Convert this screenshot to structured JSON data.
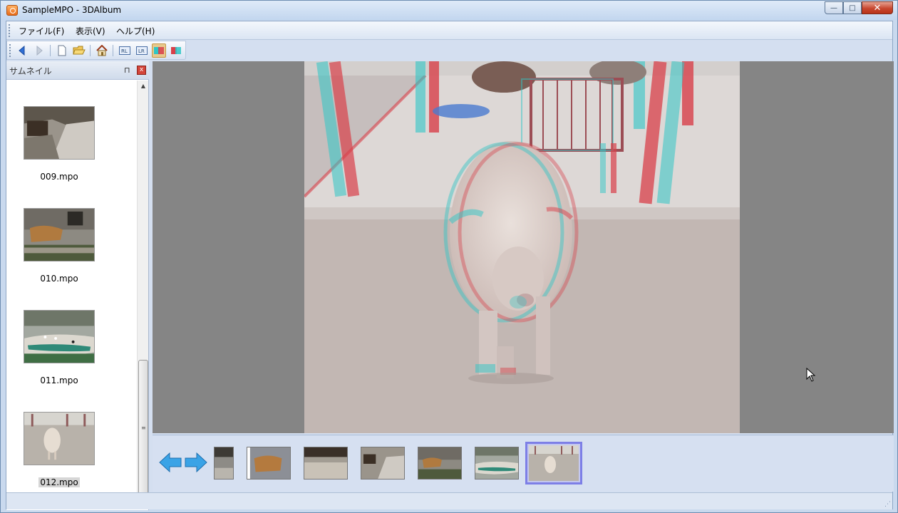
{
  "window": {
    "title": "SampleMPO - 3DAlbum",
    "controls": {
      "minimize": "—",
      "maximize": "□",
      "close": "✕"
    }
  },
  "menu": {
    "items": [
      "ファイル(F)",
      "表示(V)",
      "ヘルプ(H)"
    ]
  },
  "toolbar": {
    "buttons": [
      {
        "name": "back",
        "icon": "back-arrow-icon"
      },
      {
        "name": "forward",
        "icon": "forward-arrow-icon"
      },
      {
        "name": "new",
        "icon": "new-file-icon"
      },
      {
        "name": "open",
        "icon": "open-folder-icon"
      },
      {
        "name": "home",
        "icon": "home-icon"
      },
      {
        "name": "rl",
        "icon": "rl-view-icon"
      },
      {
        "name": "lr",
        "icon": "lr-view-icon"
      },
      {
        "name": "anaglyph",
        "icon": "anaglyph-icon",
        "active": true
      },
      {
        "name": "anaglyph-alt",
        "icon": "anaglyph-alt-icon"
      }
    ]
  },
  "thumbnail_panel": {
    "title": "サムネイル",
    "pin": "⊓",
    "close": "x",
    "items": [
      {
        "label": "009.mpo"
      },
      {
        "label": "010.mpo"
      },
      {
        "label": "011.mpo"
      },
      {
        "label": "012.mpo",
        "selected": true
      }
    ]
  },
  "filmstrip": {
    "count": 7,
    "selected_index": 6
  },
  "colors": {
    "accent": "#7d7fe6",
    "viewer_bg": "#858585",
    "anaglyph_red": "#d8404a",
    "anaglyph_cyan": "#2fc6c6"
  }
}
